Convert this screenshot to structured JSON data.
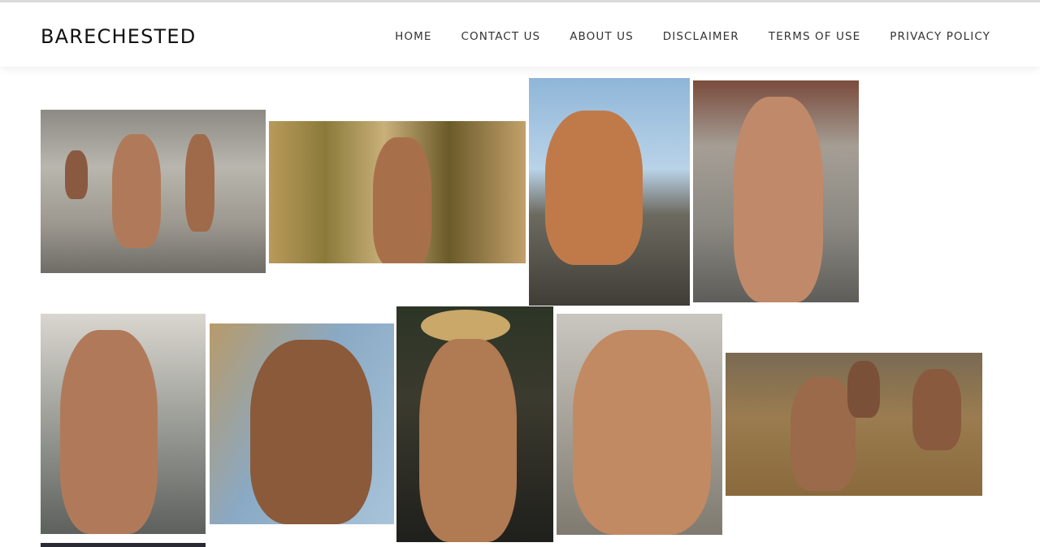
{
  "site": {
    "title": "BARECHESTED"
  },
  "nav": {
    "items": [
      {
        "label": "HOME"
      },
      {
        "label": "CONTACT US"
      },
      {
        "label": "ABOUT US"
      },
      {
        "label": "DISCLAIMER"
      },
      {
        "label": "TERMS OF USE"
      },
      {
        "label": "PRIVACY POLICY"
      }
    ]
  },
  "colors": {
    "header_bg": "#ffffff",
    "logo_text": "#111111",
    "nav_text": "#333333",
    "page_bg": "#ffffff"
  }
}
